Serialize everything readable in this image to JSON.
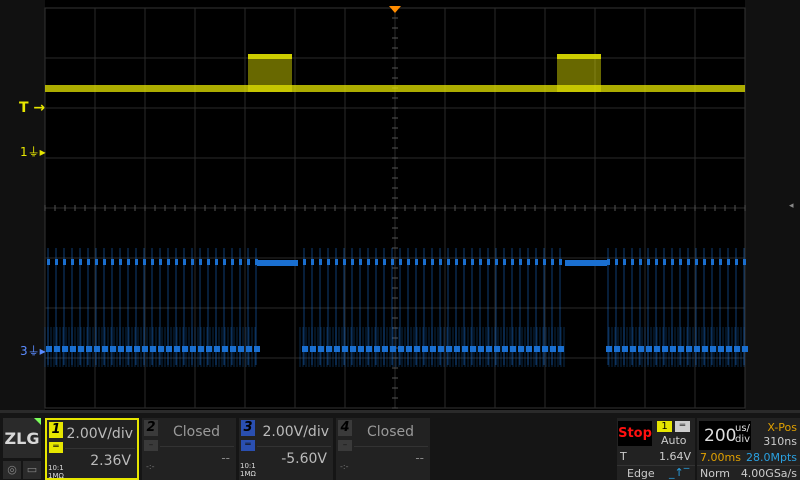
{
  "colors": {
    "ch1": "#e6e600",
    "ch3": "#1a6fd0",
    "trigger_marker": "#ff8c00",
    "stop": "#ff1010",
    "orange_text": "#e0a000",
    "blue_text": "#2aa0e0"
  },
  "markers": {
    "trigger": "T",
    "ch1": "1",
    "ch3": "3"
  },
  "logo": "ZLG",
  "channels": [
    {
      "num": "1",
      "volts_div": "2.00V/div",
      "offset": "2.36V",
      "probe": "10:1",
      "impedance": "1MΩ",
      "coupling": "DC",
      "active": true
    },
    {
      "num": "2",
      "status": "Closed",
      "offset": "--",
      "dim": "-:-"
    },
    {
      "num": "3",
      "volts_div": "2.00V/div",
      "offset": "-5.60V",
      "probe": "10:1",
      "impedance": "1MΩ",
      "coupling": "DC"
    },
    {
      "num": "4",
      "status": "Closed",
      "offset": "--",
      "dim": "-:-"
    }
  ],
  "trigger": {
    "run_state": "Stop",
    "source": "1",
    "mode": "Auto",
    "level_label": "T",
    "level": "1.64V",
    "type": "Edge",
    "slope": "rising"
  },
  "timebase": {
    "value": "200",
    "unit_top": "us/",
    "unit_bottom": "div",
    "xpos_label": "X-Pos",
    "xpos": "310ns",
    "record_time": "7.00ms",
    "memory_depth": "28.0Mpts",
    "acq_mode": "Norm",
    "sample_rate": "4.00GSa/s"
  }
}
